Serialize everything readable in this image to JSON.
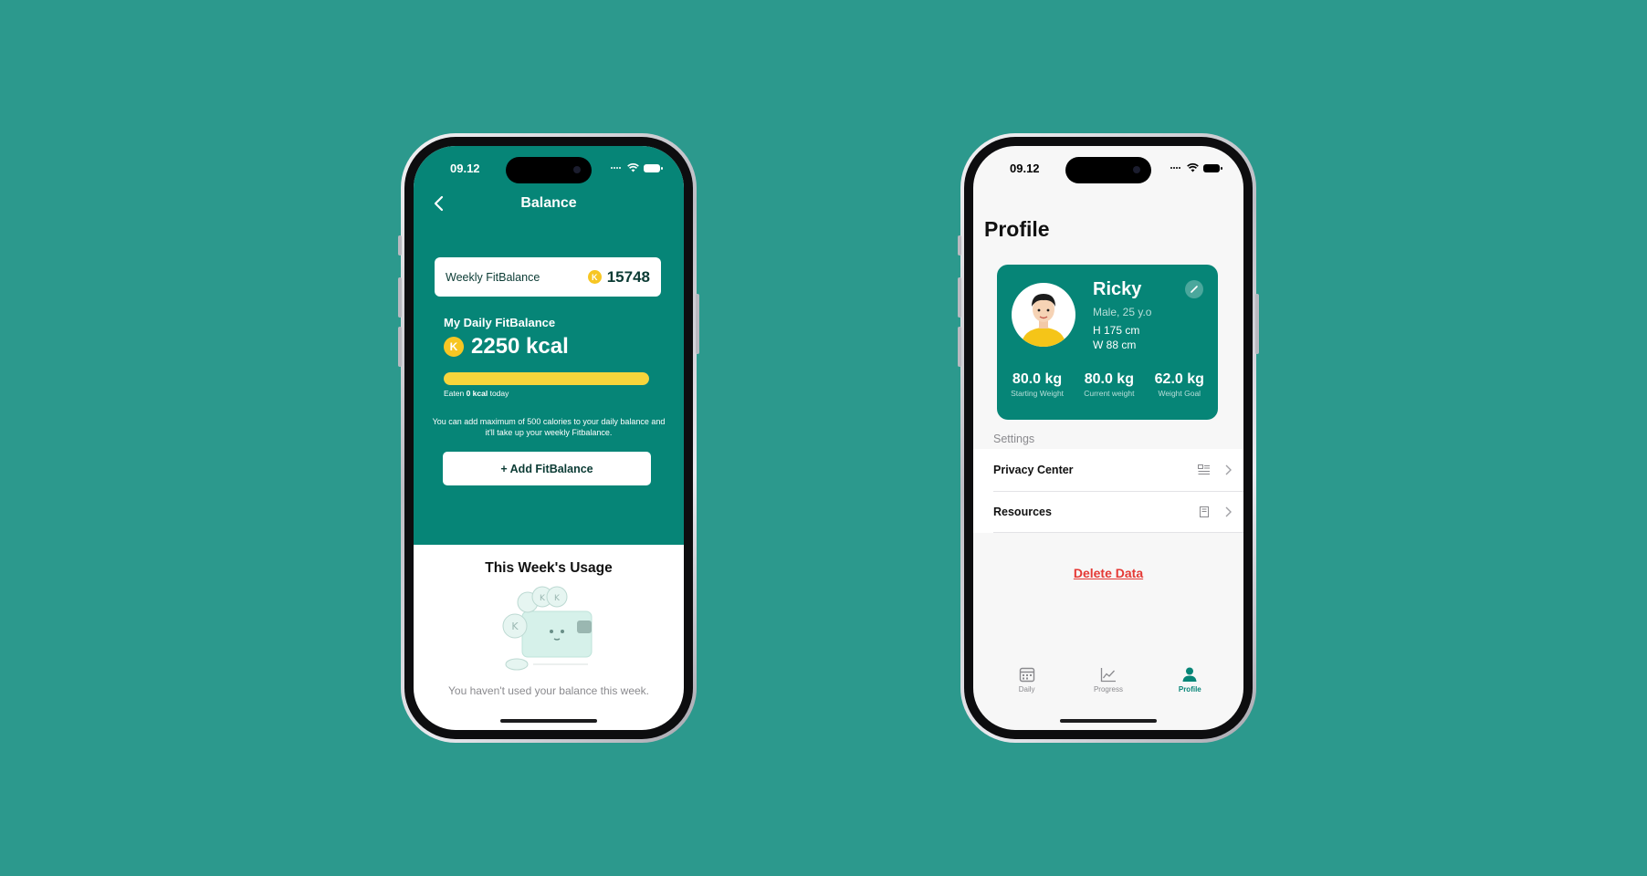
{
  "balance_screen": {
    "status": {
      "time": "09.12"
    },
    "nav": {
      "title": "Balance"
    },
    "weekly": {
      "label": "Weekly FitBalance",
      "coin_symbol": "K",
      "value": "15748"
    },
    "daily": {
      "label": "My Daily FitBalance",
      "coin_symbol": "K",
      "value": "2250 kcal",
      "progress_fraction": 1.0,
      "eaten_prefix": "Eaten ",
      "eaten_value": "0 kcal",
      "eaten_suffix": " today"
    },
    "info_text": "You can add maximum of 500 calories to your daily balance and it'll take up your weekly Fitbalance.",
    "add_button_label": "+ Add FitBalance",
    "usage": {
      "title": "This Week's Usage",
      "empty_text": "You haven't used your balance this week."
    }
  },
  "profile_screen": {
    "status": {
      "time": "09.12"
    },
    "title": "Profile",
    "user": {
      "name": "Ricky",
      "meta": "Male, 25 y.o",
      "height": "H 175 cm",
      "weight": "W 88 cm"
    },
    "stats": [
      {
        "value": "80.0 kg",
        "label": "Starting Weight"
      },
      {
        "value": "80.0 kg",
        "label": "Current weight"
      },
      {
        "value": "62.0 kg",
        "label": "Weight Goal"
      }
    ],
    "settings_label": "Settings",
    "settings": [
      {
        "label": "Privacy Center",
        "icon": "privacy-list-icon"
      },
      {
        "label": "Resources",
        "icon": "book-icon"
      }
    ],
    "delete_label": "Delete Data",
    "tabs": [
      {
        "label": "Daily",
        "icon": "calendar-icon",
        "active": false
      },
      {
        "label": "Progress",
        "icon": "chart-line-icon",
        "active": false
      },
      {
        "label": "Profile",
        "icon": "person-icon",
        "active": true
      }
    ]
  },
  "colors": {
    "background": "#2c998d",
    "brand_green": "#068577",
    "coin_yellow": "#f7c623",
    "progress_yellow": "#f7d53b",
    "danger_red": "#e53935"
  }
}
